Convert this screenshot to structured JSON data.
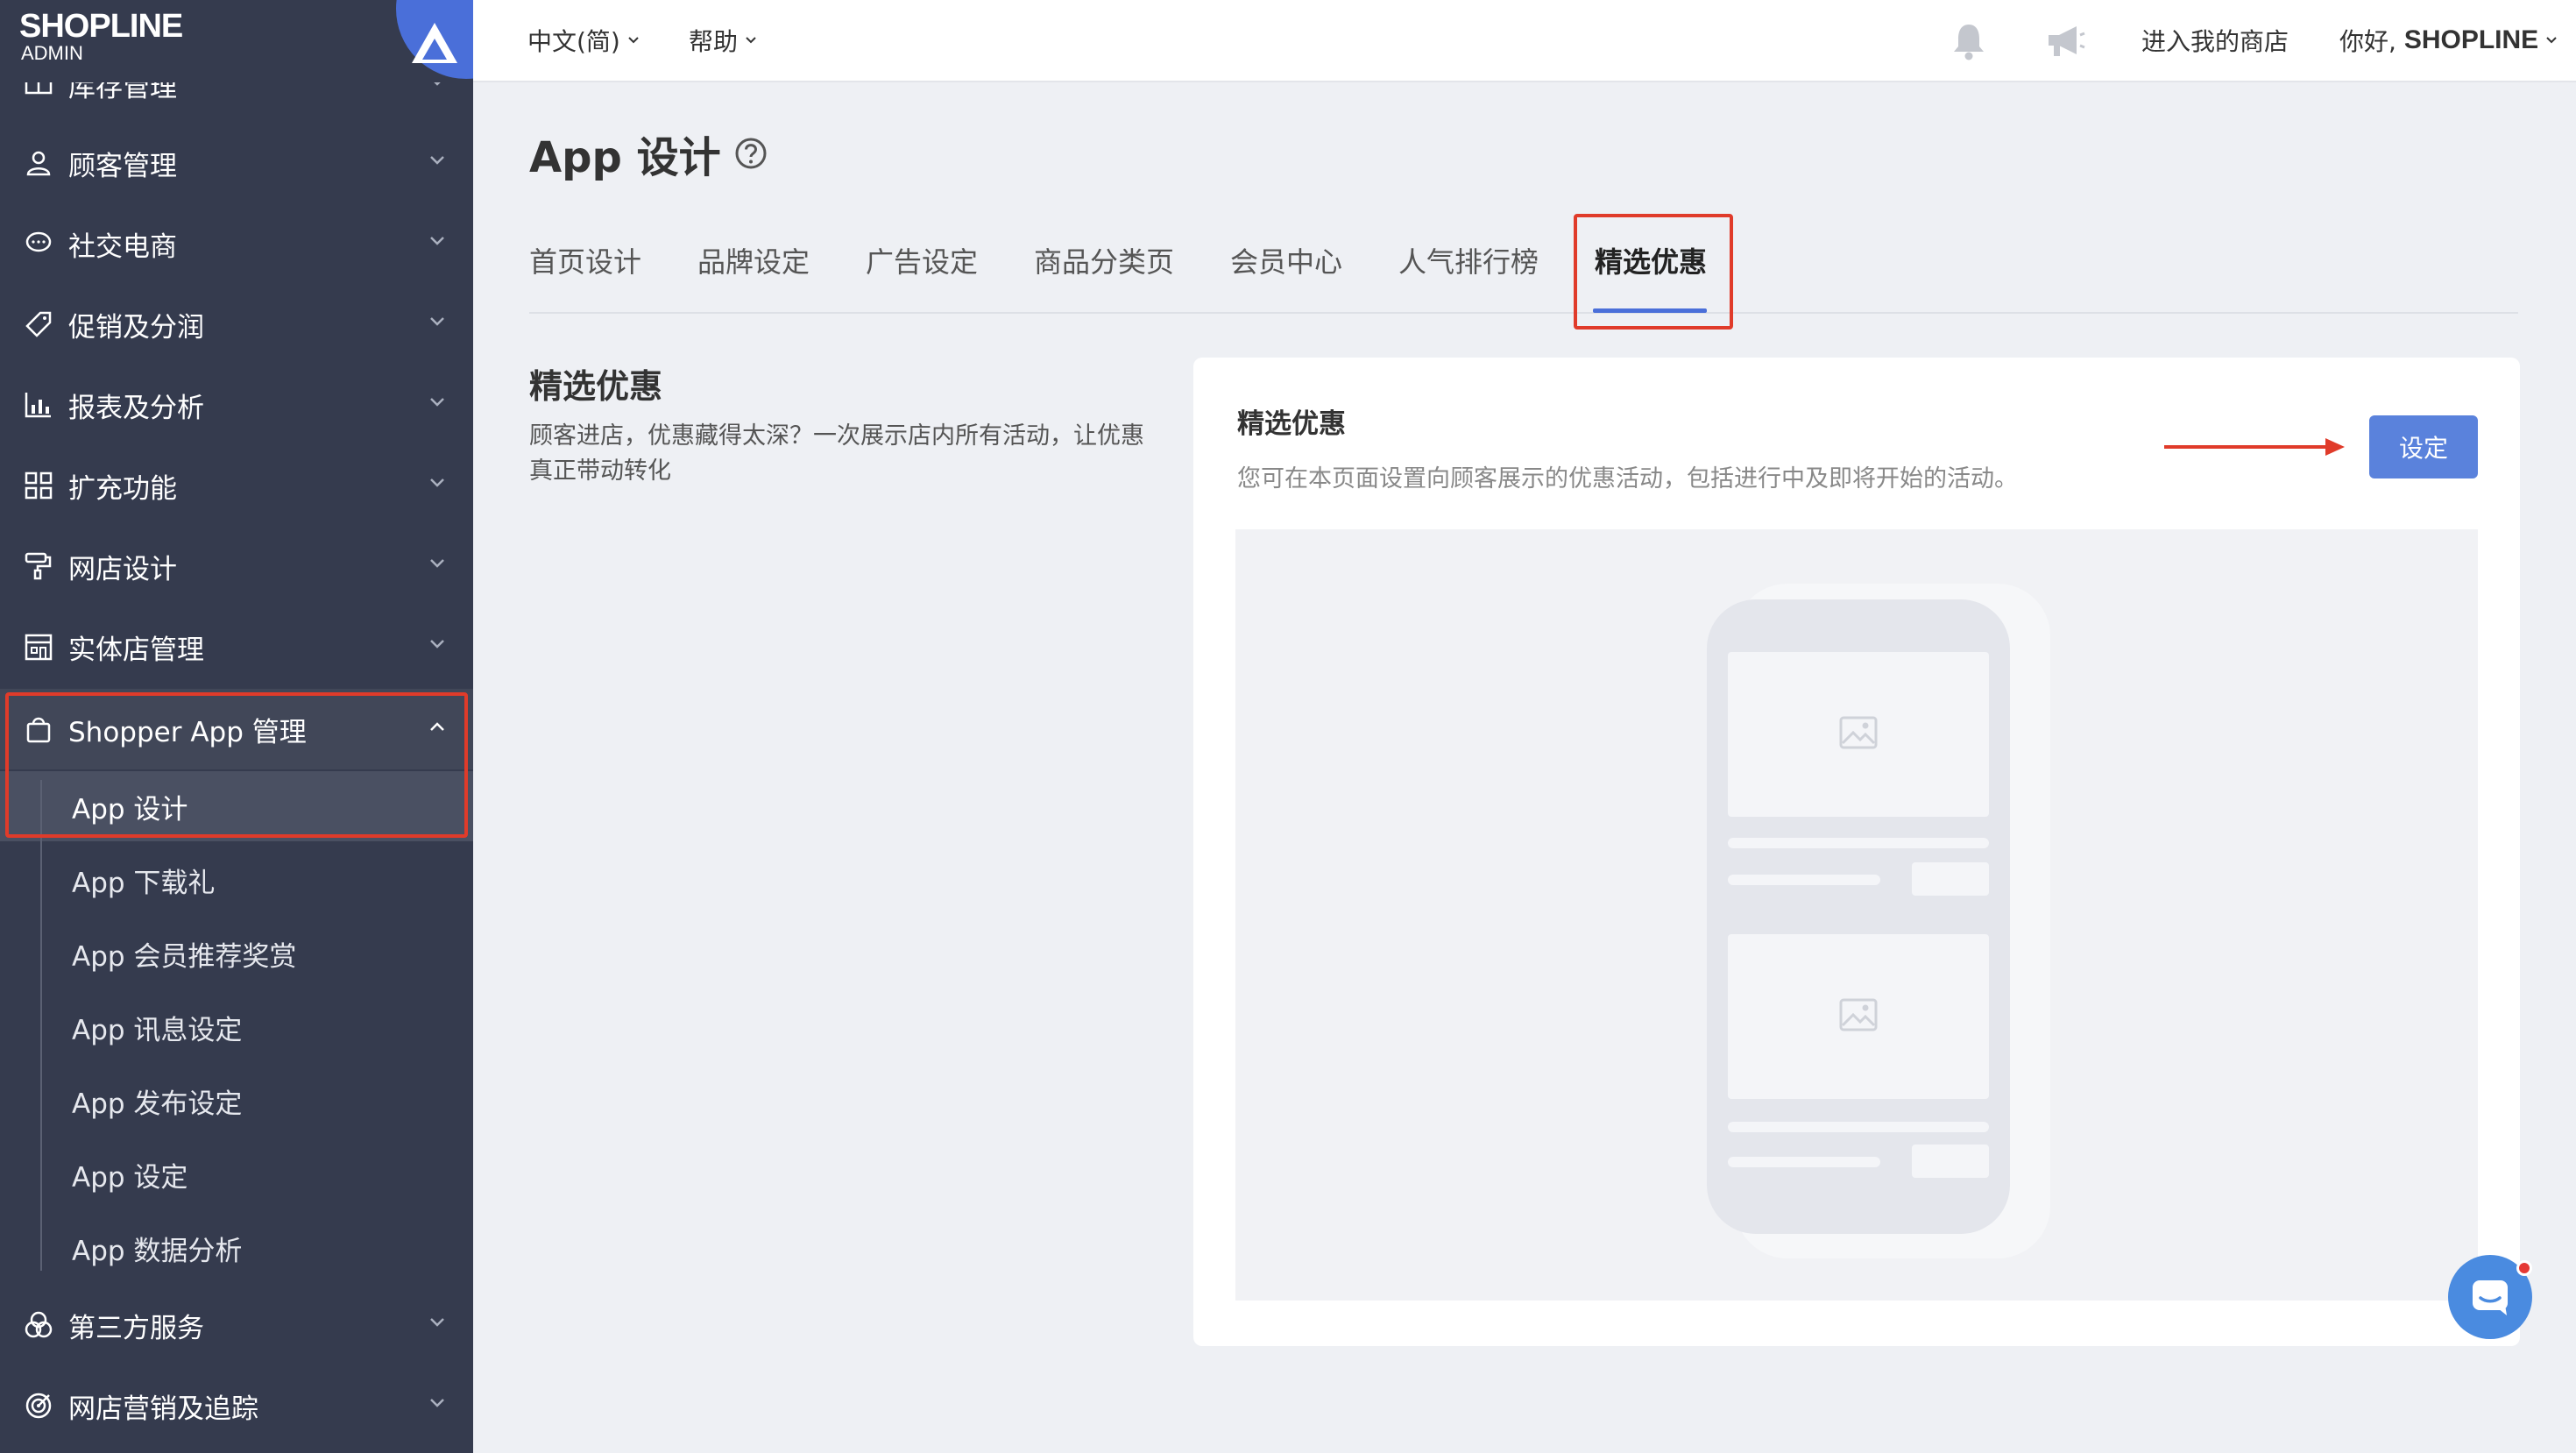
{
  "brand": {
    "logo": "SHOPLINE",
    "sub": "ADMIN"
  },
  "topbar": {
    "language": "中文(简)",
    "help": "帮助",
    "enter_store": "进入我的商店",
    "greeting": "你好, ",
    "user": "SHOPLINE",
    "icons": [
      "bell-icon",
      "megaphone-icon"
    ]
  },
  "sidebar": {
    "items": [
      {
        "label": "库存管理",
        "icon": "inventory-icon"
      },
      {
        "label": "顾客管理",
        "icon": "user-icon"
      },
      {
        "label": "社交电商",
        "icon": "chat-icon"
      },
      {
        "label": "促销及分润",
        "icon": "tag-icon"
      },
      {
        "label": "报表及分析",
        "icon": "chart-icon"
      },
      {
        "label": "扩充功能",
        "icon": "apps-icon"
      },
      {
        "label": "网店设计",
        "icon": "paint-roller-icon"
      },
      {
        "label": "实体店管理",
        "icon": "store-icon"
      },
      {
        "label": "Shopper App 管理",
        "icon": "shopping-bag-icon"
      },
      {
        "label": "第三方服务",
        "icon": "third-party-icon"
      },
      {
        "label": "网店营销及追踪",
        "icon": "target-icon"
      }
    ],
    "sub_items": [
      "App 设计",
      "App 下载礼",
      "App 会员推荐奖赏",
      "App 讯息设定",
      "App 发布设定",
      "App 设定",
      "App 数据分析"
    ],
    "active_sub": "App 设计"
  },
  "page": {
    "title": "App 设计",
    "tabs": [
      "首页设计",
      "品牌设定",
      "广告设定",
      "商品分类页",
      "会员中心",
      "人气排行榜",
      "精选优惠"
    ],
    "active_tab": "精选优惠",
    "section_title": "精选优惠",
    "section_desc": "顾客进店，优惠藏得太深？一次展示店内所有活动，让优惠真正带动转化"
  },
  "card": {
    "title": "精选优惠",
    "desc": "您可在本页面设置向顾客展示的优惠活动，包括进行中及即将开始的活动。",
    "button": "设定"
  },
  "colors": {
    "sidebar": "#353b4e",
    "accent": "#5a82dc",
    "highlight": "#e03b2a"
  }
}
